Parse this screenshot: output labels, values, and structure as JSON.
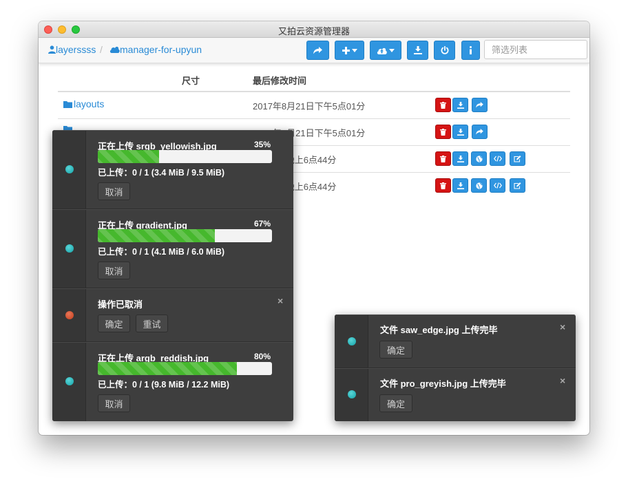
{
  "window": {
    "title": "又拍云资源管理器"
  },
  "breadcrumb": {
    "user": "layerssss",
    "separator": "/",
    "bucket": "manager-for-upyun"
  },
  "toolbar": {
    "buttons": [
      {
        "icon": "share-icon"
      },
      {
        "icon": "plus-dropdown-icon"
      },
      {
        "icon": "cloud-upload-dropdown-icon"
      },
      {
        "icon": "download-icon"
      },
      {
        "icon": "power-icon"
      },
      {
        "icon": "info-icon"
      }
    ],
    "filter_placeholder": "筛选列表"
  },
  "table": {
    "headers": {
      "size": "尺寸",
      "modified": "最后修改时间"
    },
    "rows": [
      {
        "name": "layouts",
        "type": "folder",
        "modified": "2017年8月21日下午5点01分"
      },
      {
        "name": "",
        "type": "folder",
        "modified": "2017年8月21日下午5点01分"
      },
      {
        "name": "",
        "type": "file",
        "modified": "8月22日晚上6点44分"
      },
      {
        "name": "",
        "type": "file",
        "modified": "8月22日晚上6点44分"
      }
    ]
  },
  "notifications_left": [
    {
      "title": "正在上传 srgb_yellowish.jpg",
      "percent_label": "35%",
      "progress": 0.35,
      "detail": "已上传：0 / 1 (3.4 MiB / 9.5 MiB)",
      "cancel_label": "取消"
    },
    {
      "title": "正在上传 gradient.jpg",
      "percent_label": "67%",
      "progress": 0.67,
      "detail": "已上传：0 / 1 (4.1 MiB / 6.0 MiB)",
      "cancel_label": "取消"
    },
    {
      "title": "操作已取消",
      "confirm_label": "确定",
      "retry_label": "重试",
      "close": "×"
    },
    {
      "title": "正在上传 argb_reddish.jpg",
      "percent_label": "80%",
      "progress": 0.8,
      "detail": "已上传：0 / 1 (9.8 MiB / 12.2 MiB)",
      "cancel_label": "取消"
    }
  ],
  "notifications_right": [
    {
      "title": "文件 saw_edge.jpg 上传完毕",
      "confirm_label": "确定",
      "close": "×"
    },
    {
      "title": "文件 pro_greyish.jpg 上传完毕",
      "confirm_label": "确定",
      "close": "×"
    }
  ],
  "colors": {
    "primary": "#2f95e0",
    "danger": "#d51414",
    "progress": "#46b82d",
    "panel": "#3e3e3e",
    "link": "#2a8bd6"
  }
}
